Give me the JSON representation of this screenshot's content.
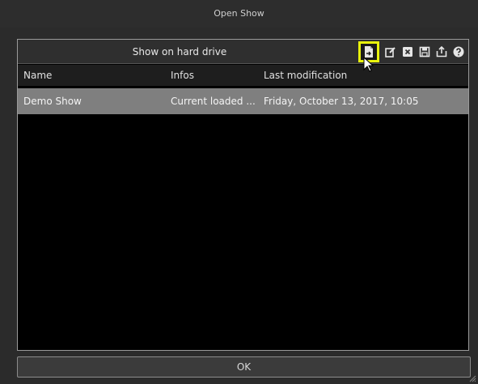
{
  "window": {
    "title": "Open Show"
  },
  "panel": {
    "title": "Show on hard drive",
    "toolbar": [
      {
        "icon": "open-file-icon",
        "highlighted": true
      },
      {
        "icon": "edit-icon"
      },
      {
        "icon": "delete-icon"
      },
      {
        "icon": "save-icon"
      },
      {
        "icon": "export-icon"
      },
      {
        "icon": "help-icon"
      }
    ]
  },
  "table": {
    "columns": [
      "Name",
      "Infos",
      "Last modification"
    ],
    "rows": [
      {
        "name": "Demo Show",
        "infos": "Current loaded ...",
        "modified": "Friday, October 13, 2017, 10:05",
        "selected": true
      }
    ]
  },
  "footer": {
    "ok_label": "OK"
  },
  "colors": {
    "highlight": "#e8f20c",
    "selected_row": "#7f7f7f",
    "panel_bg": "#000000"
  }
}
